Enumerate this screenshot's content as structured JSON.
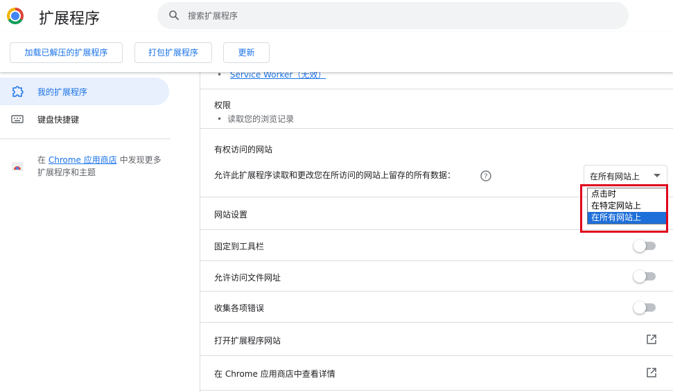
{
  "header": {
    "title": "扩展程序",
    "search_placeholder": "搜索扩展程序",
    "logo_icon": "chrome-logo-icon",
    "search_icon": "search-icon"
  },
  "toolbar": {
    "load_unpacked": "加载已解压的扩展程序",
    "pack_extension": "打包扩展程序",
    "update": "更新"
  },
  "sidebar": {
    "items": [
      {
        "label": "我的扩展程序",
        "icon": "puzzle-icon",
        "active": true
      },
      {
        "label": "键盘快捷键",
        "icon": "keyboard-icon",
        "active": false
      }
    ],
    "store_prefix": "在",
    "store_link": "Chrome 应用商店",
    "store_suffix": "中发现更多扩展程序和主题",
    "store_icon": "chrome-web-store-icon"
  },
  "details": {
    "service_worker_link": "Service Worker（无效）",
    "permissions_title": "权限",
    "permissions": [
      "读取您的浏览记录"
    ],
    "site_access_title": "有权访问的网站",
    "site_access_desc": "允许此扩展程序读取和更改您在所访问的网站上留存的所有数据：",
    "site_access_select": {
      "value": "在所有网站上",
      "options": [
        "点击时",
        "在特定网站上",
        "在所有网站上"
      ],
      "selected_index": 2
    },
    "site_settings": "网站设置",
    "pin_to_toolbar": "固定到工具栏",
    "allow_file_urls": "允许访问文件网址",
    "collect_errors": "收集各项错误",
    "open_extension_site": "打开扩展程序网站",
    "view_in_store": "在 Chrome 应用商店中查看详情",
    "toggles": {
      "pin_to_toolbar": false,
      "allow_file_urls": false,
      "collect_errors": false
    }
  },
  "colors": {
    "accent": "#1a73e8",
    "highlight": "#e0001b",
    "selected_option": "#1e6fd9"
  }
}
